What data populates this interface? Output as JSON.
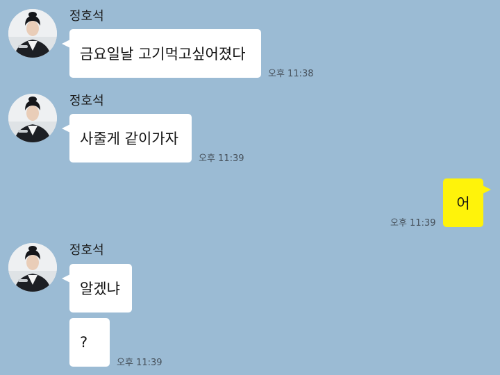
{
  "colors": {
    "chat_background": "#9bbbd4",
    "incoming_bubble": "#ffffff",
    "outgoing_bubble": "#fff30a"
  },
  "messages": [
    {
      "sender": "정호석",
      "text": "금요일날 고기먹고싶어졌다",
      "time": "오후 11:38"
    },
    {
      "sender": "정호석",
      "text": "사줄게 같이가자",
      "time": "오후 11:39"
    },
    {
      "text": "어",
      "time": "오후 11:39"
    },
    {
      "sender": "정호석",
      "text": "알겠냐"
    },
    {
      "text": "?",
      "time": "오후 11:39"
    }
  ]
}
